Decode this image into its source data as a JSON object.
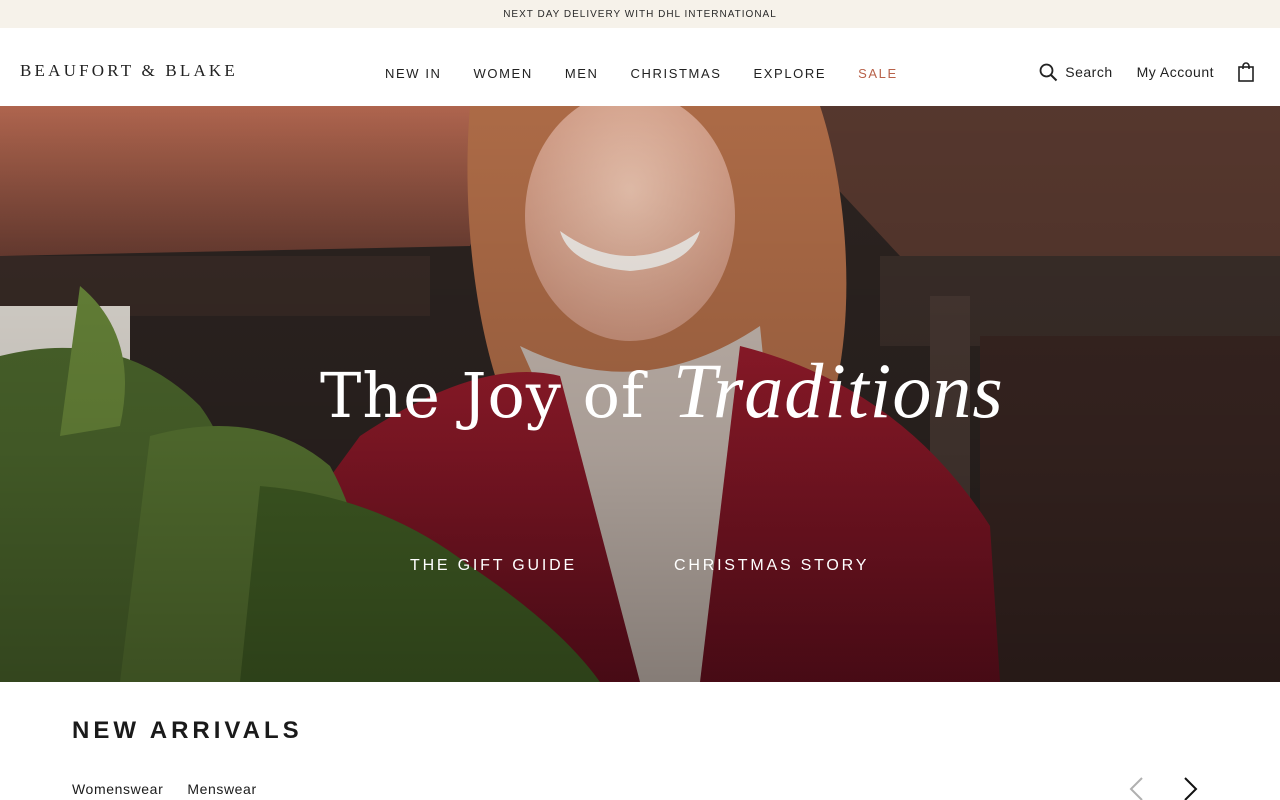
{
  "promo": {
    "text": "NEXT DAY DELIVERY WITH DHL INTERNATIONAL"
  },
  "header": {
    "logo": "BEAUFORT & BLAKE",
    "nav": [
      "NEW IN",
      "WOMEN",
      "MEN",
      "CHRISTMAS",
      "EXPLORE",
      "SALE"
    ],
    "search_label": "Search",
    "account_label": "My Account",
    "icons": {
      "search": "search-icon",
      "bag": "shopping-bag-icon"
    },
    "sale_color": "#b8624a"
  },
  "hero": {
    "headline_serif": "The Joy of",
    "headline_script": "Traditions",
    "links": [
      "THE GIFT GUIDE",
      "CHRISTMAS STORY"
    ]
  },
  "arrivals": {
    "title": "NEW ARRIVALS",
    "tabs": [
      "Womenswear",
      "Menswear"
    ],
    "icons": {
      "prev": "chevron-left-icon",
      "next": "chevron-right-icon"
    }
  },
  "colors": {
    "promo_bg": "#f6f2ea",
    "accent": "#b8624a",
    "text": "#1a1a1a"
  }
}
